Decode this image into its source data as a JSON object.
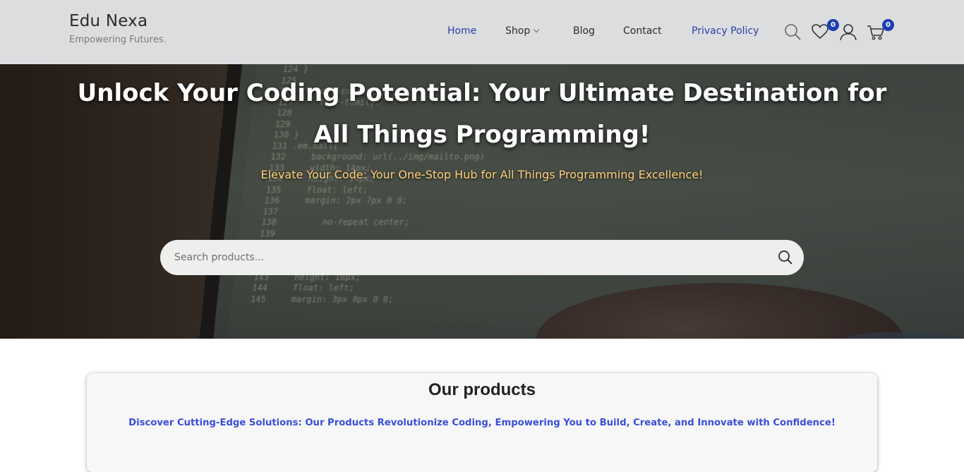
{
  "header": {
    "site_title": "Edu Nexa",
    "tagline": "Empowering Futures.",
    "nav": [
      {
        "label": "Home"
      },
      {
        "label": "Shop"
      },
      {
        "label": "Blog"
      },
      {
        "label": "Contact"
      },
      {
        "label": "Privacy Policy"
      }
    ],
    "wishlist_count": "0",
    "cart_count": "0",
    "icons": [
      "search-icon",
      "heart-icon",
      "user-icon",
      "cart-icon"
    ],
    "accent_color": "#2a3fa8"
  },
  "hero": {
    "title": "Unlock Your Coding Potential: Your Ultimate Destination for All Things Programming!",
    "subtitle": "Elevate Your Code: Your One-Stop Hub for All Things Programming Excellence!",
    "search_placeholder": "Search products..."
  },
  "products": {
    "title": "Our products",
    "subtitle": "Discover Cutting-Edge Solutions: Our Products Revolutionize Coding, Empowering You to Build, Create, and Innovate with Confidence!"
  }
}
